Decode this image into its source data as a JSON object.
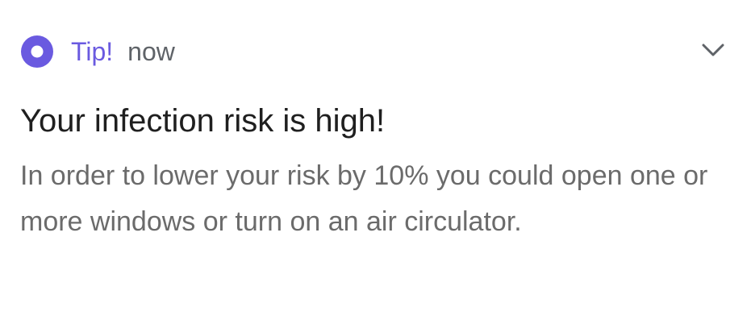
{
  "notification": {
    "app_icon": "ring-icon",
    "app_name": "Tip!",
    "timestamp": "now",
    "expand_icon": "chevron-down-icon",
    "title": "Your infection risk is high!",
    "body": "In order to lower your risk by 10% you could open one or more windows or turn on an air circulator."
  },
  "colors": {
    "accent": "#6a5ae0",
    "title_text": "#1f1f1f",
    "secondary_text": "#6b6b6b",
    "background": "#ffffff"
  }
}
